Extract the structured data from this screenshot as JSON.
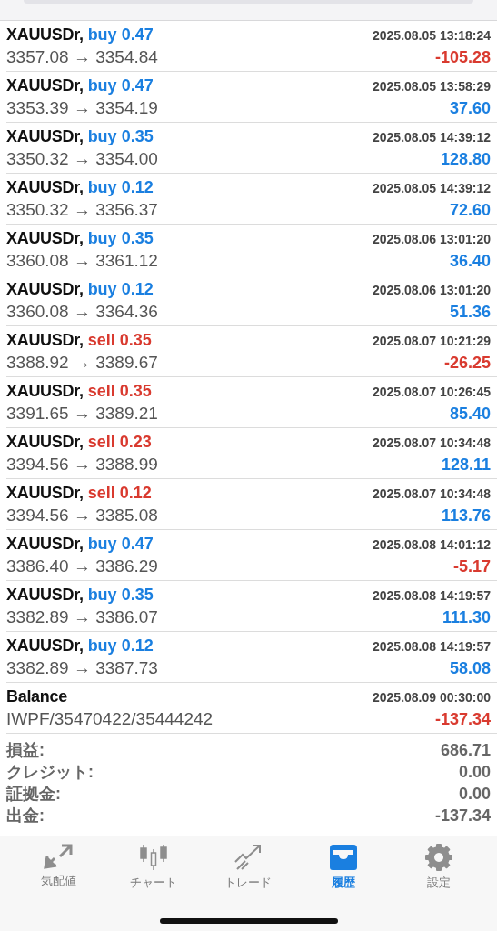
{
  "deals": [
    {
      "kind": "trade",
      "symbol": "XAUUSDr,",
      "order": "buy 0.47",
      "color": "#1a7fe0",
      "time": "2025.08.05 13:18:24",
      "prices": "3357.08 → 3354.84",
      "profit": "-105.28",
      "loss": true
    },
    {
      "kind": "trade",
      "symbol": "XAUUSDr,",
      "order": "buy 0.47",
      "color": "#1a7fe0",
      "time": "2025.08.05 13:58:29",
      "prices": "3353.39 → 3354.19",
      "profit": "37.60",
      "loss": false
    },
    {
      "kind": "trade",
      "symbol": "XAUUSDr,",
      "order": "buy 0.35",
      "color": "#1a7fe0",
      "time": "2025.08.05 14:39:12",
      "prices": "3350.32 → 3354.00",
      "profit": "128.80",
      "loss": false
    },
    {
      "kind": "trade",
      "symbol": "XAUUSDr,",
      "order": "buy 0.12",
      "color": "#1a7fe0",
      "time": "2025.08.05 14:39:12",
      "prices": "3350.32 → 3356.37",
      "profit": "72.60",
      "loss": false
    },
    {
      "kind": "trade",
      "symbol": "XAUUSDr,",
      "order": "buy 0.35",
      "color": "#1a7fe0",
      "time": "2025.08.06 13:01:20",
      "prices": "3360.08 → 3361.12",
      "profit": "36.40",
      "loss": false
    },
    {
      "kind": "trade",
      "symbol": "XAUUSDr,",
      "order": "buy 0.12",
      "color": "#1a7fe0",
      "time": "2025.08.06 13:01:20",
      "prices": "3360.08 → 3364.36",
      "profit": "51.36",
      "loss": false
    },
    {
      "kind": "trade",
      "symbol": "XAUUSDr,",
      "order": "sell 0.35",
      "color": "#d93a2f",
      "time": "2025.08.07 10:21:29",
      "prices": "3388.92 → 3389.67",
      "profit": "-26.25",
      "loss": true
    },
    {
      "kind": "trade",
      "symbol": "XAUUSDr,",
      "order": "sell 0.35",
      "color": "#d93a2f",
      "time": "2025.08.07 10:26:45",
      "prices": "3391.65 → 3389.21",
      "profit": "85.40",
      "loss": false
    },
    {
      "kind": "trade",
      "symbol": "XAUUSDr,",
      "order": "sell 0.23",
      "color": "#d93a2f",
      "time": "2025.08.07 10:34:48",
      "prices": "3394.56 → 3388.99",
      "profit": "128.11",
      "loss": false
    },
    {
      "kind": "trade",
      "symbol": "XAUUSDr,",
      "order": "sell 0.12",
      "color": "#d93a2f",
      "time": "2025.08.07 10:34:48",
      "prices": "3394.56 → 3385.08",
      "profit": "113.76",
      "loss": false
    },
    {
      "kind": "trade",
      "symbol": "XAUUSDr,",
      "order": "buy 0.47",
      "color": "#1a7fe0",
      "time": "2025.08.08 14:01:12",
      "prices": "3386.40 → 3386.29",
      "profit": "-5.17",
      "loss": true
    },
    {
      "kind": "trade",
      "symbol": "XAUUSDr,",
      "order": "buy 0.35",
      "color": "#1a7fe0",
      "time": "2025.08.08 14:19:57",
      "prices": "3382.89 → 3386.07",
      "profit": "111.30",
      "loss": false
    },
    {
      "kind": "trade",
      "symbol": "XAUUSDr,",
      "order": "buy 0.12",
      "color": "#1a7fe0",
      "time": "2025.08.08 14:19:57",
      "prices": "3382.89 → 3387.73",
      "profit": "58.08",
      "loss": false
    },
    {
      "kind": "balance",
      "symbol": "Balance",
      "time": "2025.08.09 00:30:00",
      "prices": "IWPF/35470422/35444242",
      "profit": "-137.34",
      "loss": true
    }
  ],
  "summary": [
    {
      "label": "損益:",
      "value": "686.71"
    },
    {
      "label": "クレジット:",
      "value": "0.00"
    },
    {
      "label": "証拠金:",
      "value": "0.00"
    },
    {
      "label": "出金:",
      "value": "-137.34"
    }
  ],
  "tabs": [
    {
      "kind": "quotes",
      "label": "気配値",
      "selected": false
    },
    {
      "kind": "chart",
      "label": "チャート",
      "selected": false
    },
    {
      "kind": "trade",
      "label": "トレード",
      "selected": false
    },
    {
      "kind": "history",
      "label": "履歴",
      "selected": true
    },
    {
      "kind": "settings",
      "label": "設定",
      "selected": false
    }
  ]
}
